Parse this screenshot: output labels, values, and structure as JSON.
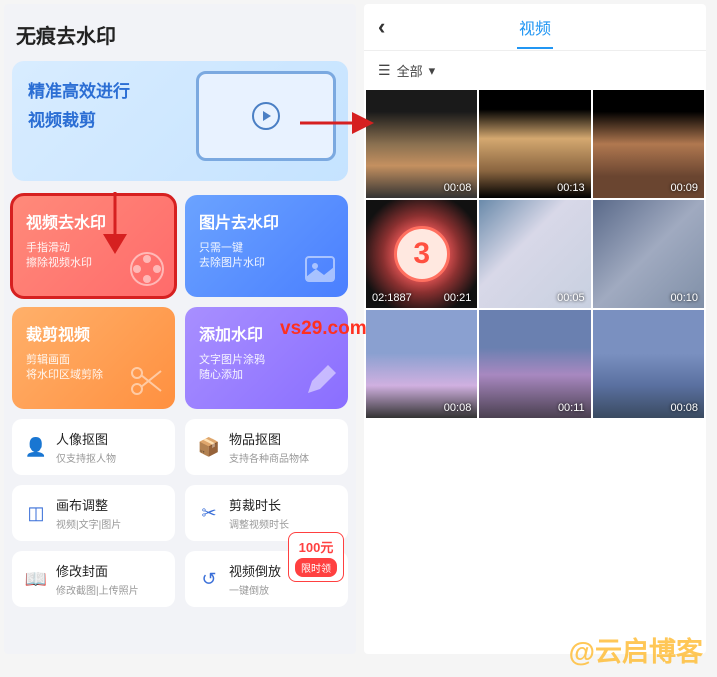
{
  "screen1": {
    "title": "无痕去水印",
    "banner": {
      "line1": "精准高效进行",
      "line2": "视频裁剪"
    },
    "cards": [
      {
        "title": "视频去水印",
        "line1": "手指滑动",
        "line2": "擦除视频水印"
      },
      {
        "title": "图片去水印",
        "line1": "只需一键",
        "line2": "去除图片水印"
      },
      {
        "title": "裁剪视频",
        "line1": "剪辑画面",
        "line2": "将水印区域剪除"
      },
      {
        "title": "添加水印",
        "line1": "文字图片涂鸦",
        "line2": "随心添加"
      }
    ],
    "list": [
      {
        "icon": "👤",
        "title": "人像抠图",
        "sub": "仅支持抠人物"
      },
      {
        "icon": "📦",
        "title": "物品抠图",
        "sub": "支持各种商品物体"
      },
      {
        "icon": "◫",
        "title": "画布调整",
        "sub": "视频|文字|图片"
      },
      {
        "icon": "✂",
        "title": "剪裁时长",
        "sub": "调整视频时长"
      },
      {
        "icon": "📖",
        "title": "修改封面",
        "sub": "修改截图|上传照片"
      },
      {
        "icon": "↺",
        "title": "视频倒放",
        "sub": "一键倒放"
      }
    ],
    "badge": {
      "amount": "100元",
      "label": "限时领"
    }
  },
  "screen2": {
    "tab": "视频",
    "filter": "全部",
    "videos": [
      {
        "dur": "00:08"
      },
      {
        "dur": "00:13"
      },
      {
        "dur": "00:09"
      },
      {
        "dur": "00:21",
        "num": "3",
        "extra": "02:1887"
      },
      {
        "dur": "00:05"
      },
      {
        "dur": "00:10"
      },
      {
        "dur": "00:08"
      },
      {
        "dur": "00:11"
      },
      {
        "dur": "00:08"
      }
    ]
  },
  "wm": {
    "url": "vs29.com",
    "blog": "@云启博客"
  }
}
